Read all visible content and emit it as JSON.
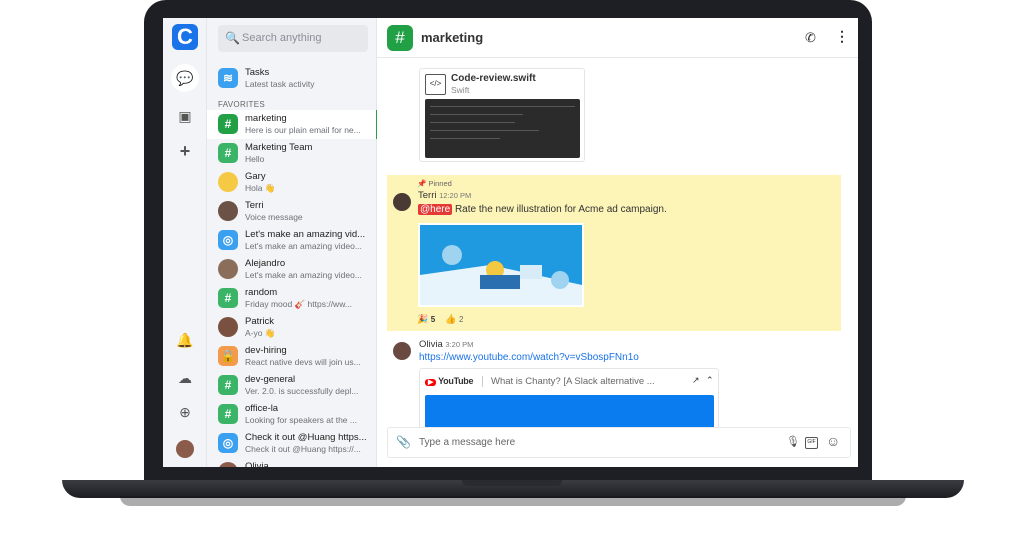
{
  "rail": {
    "logo": "C",
    "icons": [
      "chat-icon",
      "contacts-icon",
      "plus-icon",
      "bell-icon",
      "cloud-download-icon",
      "help-lifebuoy-icon",
      "user-avatar"
    ]
  },
  "search": {
    "placeholder": "Search anything"
  },
  "tasks": {
    "name": "Tasks",
    "preview": "Latest task activity"
  },
  "favorites_label": "FAVORITES",
  "conversations": [
    {
      "name": "marketing",
      "preview": "Here is our plain email for ne...",
      "type": "channel",
      "color": "#22a046"
    },
    {
      "name": "Marketing Team",
      "preview": "Hello",
      "type": "channel",
      "color": "#3cb467"
    },
    {
      "name": "Gary",
      "preview": "Hola 👋",
      "type": "user",
      "color": "#f6c944"
    },
    {
      "name": "Terri",
      "preview": "Voice message",
      "type": "user",
      "color": "#6b5146"
    },
    {
      "name": "Let's make an amazing vid...",
      "preview": "Let's make an amazing video...",
      "type": "group",
      "color": "#3ba0f0"
    },
    {
      "name": "Alejandro",
      "preview": "Let's make an amazing video...",
      "type": "user",
      "color": "#8a6e5a"
    },
    {
      "name": "random",
      "preview": "Friday mood 🎸 https://ww...",
      "type": "channel",
      "color": "#3cb467"
    },
    {
      "name": "Patrick",
      "preview": "A-yo 👋",
      "type": "user",
      "color": "#7a5040"
    },
    {
      "name": "dev-hiring",
      "preview": "React native devs will join us...",
      "type": "private",
      "color": "#f39a4c"
    },
    {
      "name": "dev-general",
      "preview": "Ver. 2.0. is successfully depl...",
      "type": "channel",
      "color": "#3cb467"
    },
    {
      "name": "office-la",
      "preview": "Looking for speakers at the ...",
      "type": "channel",
      "color": "#3cb467"
    },
    {
      "name": "Check it out @Huang https...",
      "preview": "Check it out @Huang https://...",
      "type": "group",
      "color": "#3ba0f0"
    },
    {
      "name": "Olivia",
      "preview": "",
      "type": "user",
      "color": "#8a5a4a"
    }
  ],
  "header": {
    "title": "marketing"
  },
  "file": {
    "name": "Code-review.swift",
    "lang": "Swift"
  },
  "pinned": {
    "label": "Pinned",
    "author": "Terri",
    "time": "12:20 PM",
    "mention": "@here",
    "text": "Rate the new illustration for Acme ad campaign.",
    "reactions": [
      {
        "emoji": "🎉",
        "count": "5"
      },
      {
        "emoji": "👍",
        "count": "2"
      }
    ]
  },
  "olivia": {
    "author": "Olivia",
    "time": "3:20 PM",
    "link": "https://www.youtube.com/watch?v=vSbospFNn1o",
    "preview_source": "YouTube",
    "preview_title": "What is Chanty? [A Slack alternative ..."
  },
  "composer": {
    "placeholder": "Type a message here"
  }
}
